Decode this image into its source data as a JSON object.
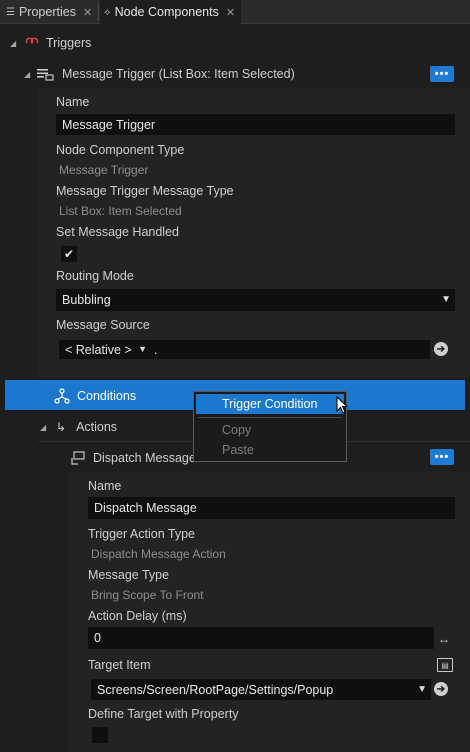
{
  "tabs": [
    {
      "label": "Properties",
      "icon": "list-icon",
      "close": "✕"
    },
    {
      "label": "Node Components",
      "icon": "node-components-icon",
      "close": "✕"
    }
  ],
  "triggers": {
    "label": "Triggers"
  },
  "message_trigger": {
    "header": "Message Trigger (List Box: Item Selected)",
    "name_label": "Name",
    "name_value": "Message Trigger",
    "component_type_label": "Node Component Type",
    "component_type_value": "Message Trigger",
    "message_type_label": "Message Trigger Message Type",
    "message_type_value": "List Box: Item Selected",
    "handled_label": "Set Message Handled",
    "handled_checked": true,
    "routing_label": "Routing Mode",
    "routing_value": "Bubbling",
    "source_label": "Message Source",
    "source_mode": "< Relative >",
    "source_value": "."
  },
  "conditions": {
    "label": "Conditions"
  },
  "context_menu": {
    "items": [
      {
        "label": "Trigger Condition",
        "enabled": true
      },
      {
        "label": "Copy",
        "enabled": false
      },
      {
        "label": "Paste",
        "enabled": false
      }
    ]
  },
  "actions": {
    "label": "Actions"
  },
  "dispatch": {
    "header": "Dispatch Message",
    "name_label": "Name",
    "name_value": "Dispatch Message",
    "action_type_label": "Trigger Action Type",
    "action_type_value": "Dispatch Message Action",
    "message_type_label": "Message Type",
    "message_type_value": "Bring Scope To Front",
    "delay_label": "Action Delay (ms)",
    "delay_value": "0",
    "target_label": "Target Item",
    "target_value": "Screens/Screen/RootPage/Settings/Popup",
    "define_target_label": "Define Target with Property",
    "define_target_checked": false
  },
  "colors": {
    "accent": "#1c78cf",
    "background": "#1e1e1e",
    "field": "#0f0f0f",
    "trigger_icon": "#e0413c"
  },
  "ellipsis": "•••"
}
